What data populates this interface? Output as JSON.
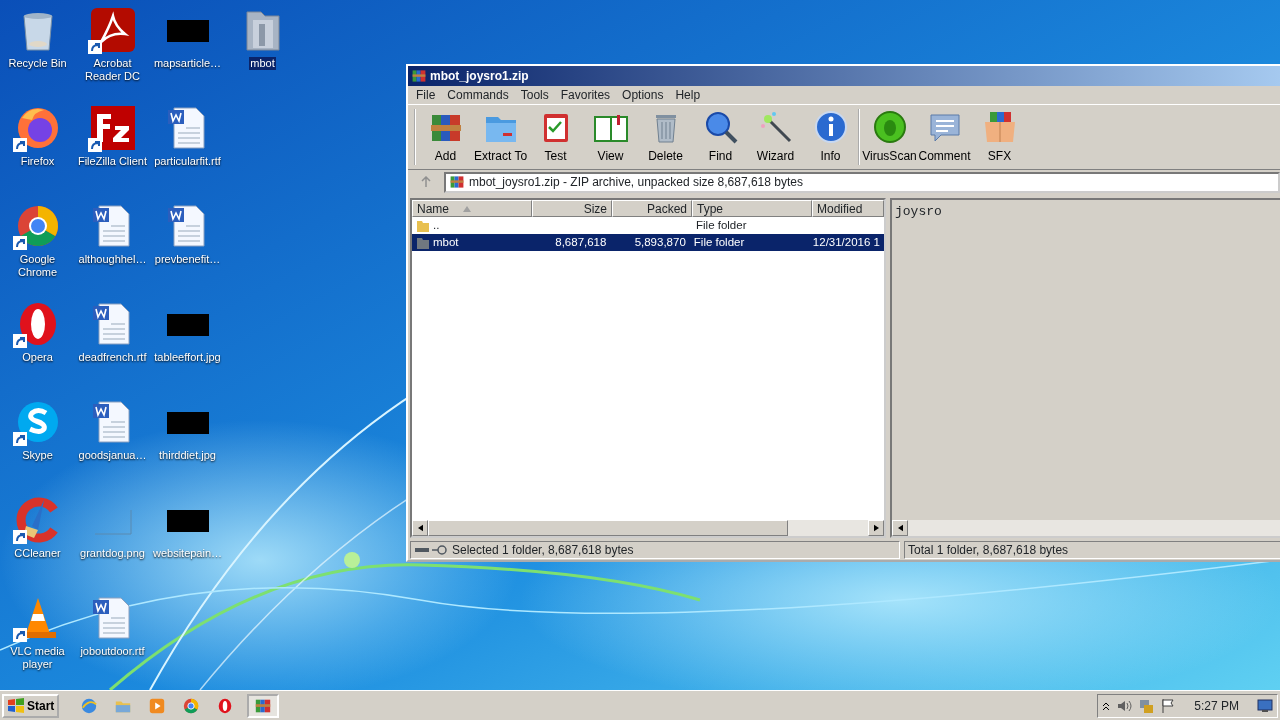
{
  "desktop": {
    "columns": [
      [
        {
          "label": "Recycle Bin",
          "kind": "recycle",
          "shortcut": false,
          "selected": false
        },
        {
          "label": "Firefox",
          "kind": "firefox",
          "shortcut": true,
          "selected": false
        },
        {
          "label": "Google Chrome",
          "kind": "chrome",
          "shortcut": true,
          "selected": false
        },
        {
          "label": "Opera",
          "kind": "opera",
          "shortcut": true,
          "selected": false
        },
        {
          "label": "Skype",
          "kind": "skype",
          "shortcut": true,
          "selected": false
        },
        {
          "label": "CCleaner",
          "kind": "ccleaner",
          "shortcut": true,
          "selected": false
        },
        {
          "label": "VLC media player",
          "kind": "vlc",
          "shortcut": true,
          "selected": false
        }
      ],
      [
        {
          "label": "Acrobat Reader DC",
          "kind": "acrobat",
          "shortcut": true,
          "selected": false
        },
        {
          "label": "FileZilla Client",
          "kind": "filezilla",
          "shortcut": true,
          "selected": false
        },
        {
          "label": "althoughhel…",
          "kind": "document",
          "shortcut": false,
          "selected": false
        },
        {
          "label": "deadfrench.rtf",
          "kind": "document",
          "shortcut": false,
          "selected": false
        },
        {
          "label": "goodsjanua…",
          "kind": "document",
          "shortcut": false,
          "selected": false
        },
        {
          "label": "grantdog.png",
          "kind": "blank-image",
          "shortcut": false,
          "selected": false
        },
        {
          "label": "joboutdoor.rtf",
          "kind": "document",
          "shortcut": false,
          "selected": false
        }
      ],
      [
        {
          "label": "mapsarticle…",
          "kind": "dark-image",
          "shortcut": false,
          "selected": false
        },
        {
          "label": "particularfit.rtf",
          "kind": "document",
          "shortcut": false,
          "selected": false
        },
        {
          "label": "prevbenefit…",
          "kind": "document",
          "shortcut": false,
          "selected": false
        },
        {
          "label": "tableeffort.jpg",
          "kind": "dark-image",
          "shortcut": false,
          "selected": false
        },
        {
          "label": "thirddiet.jpg",
          "kind": "dark-image",
          "shortcut": false,
          "selected": false
        },
        {
          "label": "websitepain…",
          "kind": "dark-image",
          "shortcut": false,
          "selected": false
        }
      ],
      [
        {
          "label": "mbot",
          "kind": "folder",
          "shortcut": false,
          "selected": true
        }
      ]
    ]
  },
  "window": {
    "title": "mbot_joysro1.zip",
    "menu": [
      "File",
      "Commands",
      "Tools",
      "Favorites",
      "Options",
      "Help"
    ],
    "toolbar": {
      "groups": [
        [
          {
            "label": "Add",
            "kind": "add"
          },
          {
            "label": "Extract To",
            "kind": "extract"
          },
          {
            "label": "Test",
            "kind": "test"
          },
          {
            "label": "View",
            "kind": "view"
          },
          {
            "label": "Delete",
            "kind": "delete"
          },
          {
            "label": "Find",
            "kind": "find"
          },
          {
            "label": "Wizard",
            "kind": "wizard"
          },
          {
            "label": "Info",
            "kind": "info"
          }
        ],
        [
          {
            "label": "VirusScan",
            "kind": "virusscan"
          },
          {
            "label": "Comment",
            "kind": "comment"
          },
          {
            "label": "SFX",
            "kind": "sfx"
          }
        ]
      ]
    },
    "address": "mbot_joysro1.zip - ZIP archive, unpacked size 8,687,618 bytes",
    "table": {
      "columns": [
        "Name",
        "Size",
        "Packed",
        "Type",
        "Modified"
      ],
      "rows": [
        {
          "name": "..",
          "type": "File folder",
          "kind": "parent",
          "selected": false
        },
        {
          "name": "mbot",
          "size": "8,687,618",
          "packed": "5,893,870",
          "type": "File folder",
          "modified": "12/31/2016 1",
          "kind": "folder",
          "selected": true
        }
      ]
    },
    "comment": "joysro",
    "status_bar": {
      "left": "Selected 1 folder, 8,687,618 bytes",
      "right": "Total 1 folder, 8,687,618 bytes"
    }
  },
  "taskbar": {
    "start": "Start",
    "apps": [
      {
        "kind": "ie",
        "active": false
      },
      {
        "kind": "explorer",
        "active": false
      },
      {
        "kind": "media",
        "active": false
      },
      {
        "kind": "chrome",
        "active": false
      },
      {
        "kind": "opera",
        "active": false
      },
      {
        "kind": "winrar",
        "active": true
      }
    ],
    "clock": "5:27 PM"
  }
}
